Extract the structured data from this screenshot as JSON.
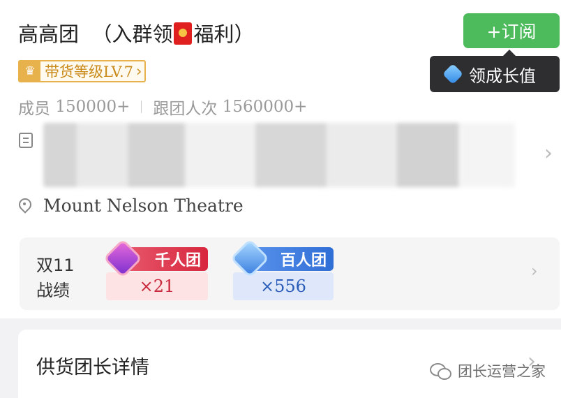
{
  "header": {
    "group_name": "高高团",
    "title_prefix": "（入群领",
    "title_suffix": "福利）",
    "subscribe_label": "+订阅",
    "tooltip_label": "领成长值"
  },
  "level_badge": {
    "label": "带货等级LV.7",
    "arrow": "›"
  },
  "stats": {
    "members_label": "成员",
    "members_value": "150000+",
    "followers_label": "跟团人次",
    "followers_value": "1560000+"
  },
  "location": {
    "name": "Mount Nelson Theatre"
  },
  "honors": {
    "event_line1": "双11",
    "event_line2": "战绩",
    "badges": [
      {
        "title": "千人团",
        "count": "×21"
      },
      {
        "title": "百人团",
        "count": "×556"
      }
    ]
  },
  "detail": {
    "title": "供货团长详情"
  },
  "watermark": {
    "text": "团长运营之家"
  },
  "icons": {
    "redpacket": "red-packet-icon",
    "crown": "crown-icon",
    "gem": "gem-icon",
    "document": "document-icon",
    "location": "location-pin-icon",
    "chevron": "chevron-right-icon",
    "wechat": "wechat-icon"
  },
  "colors": {
    "subscribe_green": "#4dbb5c",
    "level_gold": "#e7b24c",
    "tooltip_dark": "#2e2e30",
    "badge_red": "#e0435a",
    "badge_blue": "#3f7de2"
  }
}
